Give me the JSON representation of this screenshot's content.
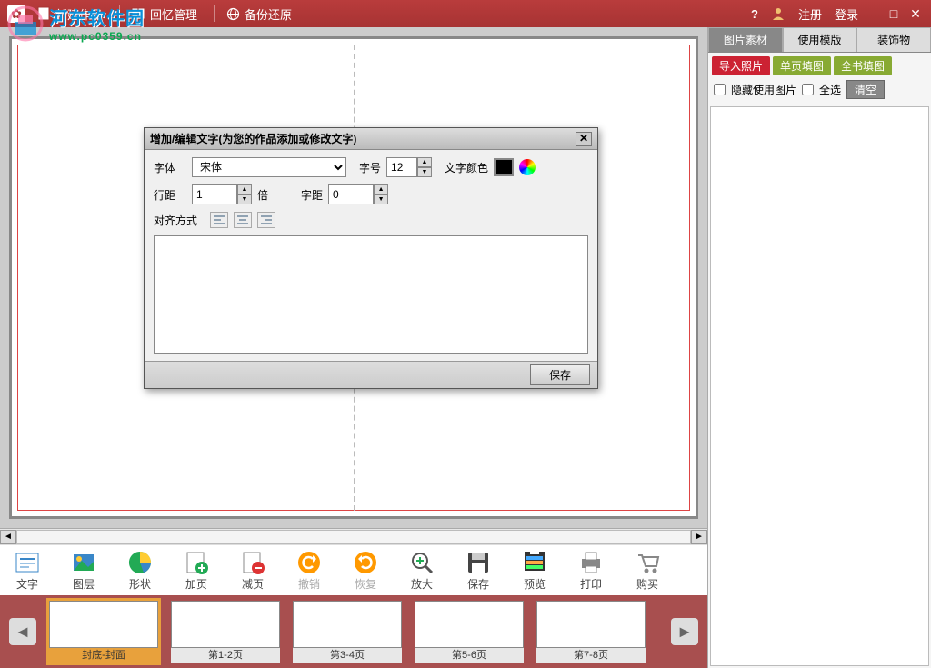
{
  "titlebar": {
    "new_work": "新建作品",
    "memory_mgmt": "回忆管理",
    "backup_restore": "备份还原",
    "register": "注册",
    "login": "登录"
  },
  "watermark": {
    "title": "河东软件园",
    "url": "www.pc0359.cn"
  },
  "toolbar": {
    "text": "文字",
    "layer": "图层",
    "shape": "形状",
    "add_page": "加页",
    "del_page": "减页",
    "undo": "撤销",
    "redo": "恢复",
    "zoom": "放大",
    "save": "保存",
    "preview": "预览",
    "print": "打印",
    "buy": "购买"
  },
  "thumbs": {
    "cover": "封底-封面",
    "p12": "第1-2页",
    "p34": "第3-4页",
    "p56": "第5-6页",
    "p78": "第7-8页"
  },
  "right": {
    "tab_material": "图片素材",
    "tab_template": "使用模版",
    "tab_decor": "装饰物",
    "import": "导入照片",
    "fill_page": "单页填图",
    "fill_book": "全书填图",
    "hide_used": "隐藏使用图片",
    "select_all": "全选",
    "clear": "清空"
  },
  "dialog": {
    "title": "增加/编辑文字(为您的作品添加或修改文字)",
    "font_label": "字体",
    "font_value": "宋体",
    "size_label": "字号",
    "size_value": "12",
    "color_label": "文字颜色",
    "line_spacing_label": "行距",
    "line_spacing_value": "1",
    "times": "倍",
    "char_spacing_label": "字距",
    "char_spacing_value": "0",
    "align_label": "对齐方式",
    "save": "保存"
  }
}
